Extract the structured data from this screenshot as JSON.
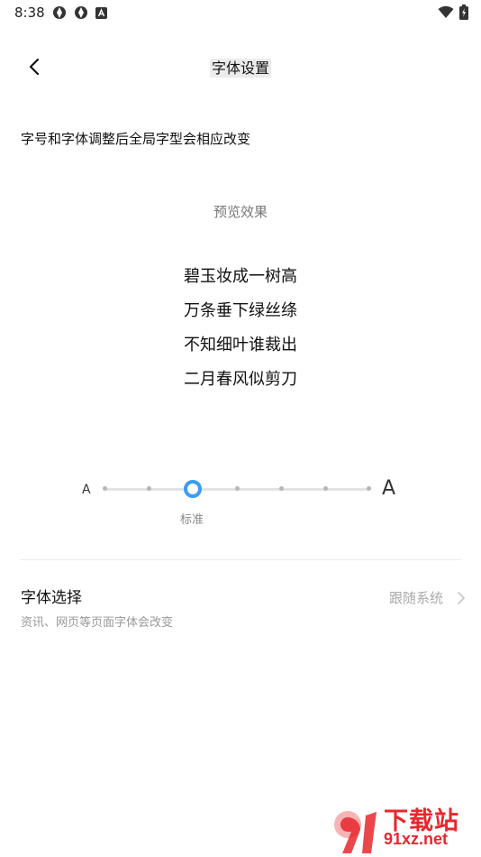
{
  "status_bar": {
    "time": "8:38",
    "left_icons": [
      "aperture-icon",
      "aperture-icon",
      "keyboard-a-icon"
    ],
    "right_icons": [
      "wifi-icon",
      "battery-charging-icon"
    ]
  },
  "header": {
    "title": "字体设置",
    "back_icon": "chevron-left-icon"
  },
  "description": "字号和字体调整后全局字型会相应改变",
  "preview": {
    "label": "预览效果",
    "lines": [
      "碧玉妆成一树高",
      "万条垂下绿丝绦",
      "不知细叶谁裁出",
      "二月春风似剪刀"
    ]
  },
  "slider": {
    "small_label": "A",
    "large_label": "A",
    "steps": 7,
    "selected_index": 2,
    "selected_caption": "标准",
    "accent_color": "#3a9cf5"
  },
  "font_selection": {
    "title": "字体选择",
    "subtitle": "资讯、网页等页面字体会改变",
    "value": "跟随系统",
    "chevron_icon": "chevron-right-icon"
  },
  "watermark": {
    "brand_cn": "下载站",
    "brand_url": "91xz.net",
    "color": "#e8272c"
  }
}
